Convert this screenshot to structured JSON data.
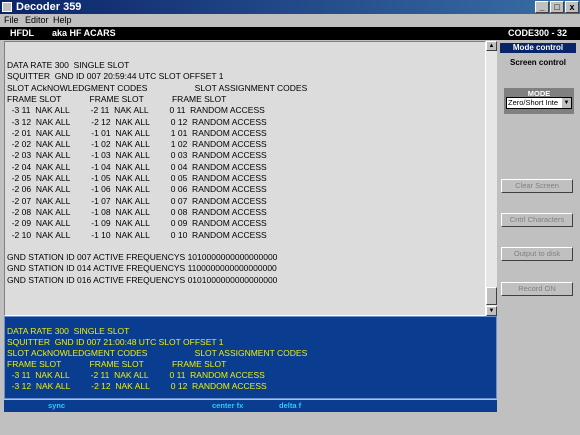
{
  "window": {
    "title": "Decoder 359"
  },
  "window_buttons": {
    "minimize": "_",
    "maximize": "□",
    "close": "x"
  },
  "menu": [
    "File",
    "Editor",
    "Help"
  ],
  "header": {
    "mode": "HFDL",
    "alias": "aka HF ACARS",
    "code": "CODE300 - 32"
  },
  "upper_lines": [
    "DATA RATE 300  SINGLE SLOT",
    "SQUITTER  GND ID 007 20:59:44 UTC SLOT OFFSET 1",
    "SLOT ACkNOWLEDGMENT CODES                    SLOT ASSIGNMENT CODES",
    "FRAME SLOT            FRAME SLOT            FRAME SLOT",
    "  -3 11  NAK ALL         -2 11  NAK ALL         0 11  RANDOM ACCESS",
    "  -3 12  NAK ALL         -2 12  NAK ALL         0 12  RANDOM ACCESS",
    "  -2 01  NAK ALL         -1 01  NAK ALL         1 01  RANDOM ACCESS",
    "  -2 02  NAK ALL         -1 02  NAK ALL         1 02  RANDOM ACCESS",
    "  -2 03  NAK ALL         -1 03  NAK ALL         0 03  RANDOM ACCESS",
    "  -2 04  NAK ALL         -1 04  NAK ALL         0 04  RANDOM ACCESS",
    "  -2 05  NAK ALL         -1 05  NAK ALL         0 05  RANDOM ACCESS",
    "  -2 06  NAK ALL         -1 06  NAK ALL         0 06  RANDOM ACCESS",
    "  -2 07  NAK ALL         -1 07  NAK ALL         0 07  RANDOM ACCESS",
    "  -2 08  NAK ALL         -1 08  NAK ALL         0 08  RANDOM ACCESS",
    "  -2 09  NAK ALL         -1 09  NAK ALL         0 09  RANDOM ACCESS",
    "  -2 10  NAK ALL         -1 10  NAK ALL         0 10  RANDOM ACCESS",
    "",
    "GND STATION ID 007 ACTIVE FREQUENCYS 1010000000000000000",
    "GND STATION ID 014 ACTIVE FREQUENCYS 1100000000000000000",
    "GND STATION ID 016 ACTIVE FREQUENCYS 0101000000000000000"
  ],
  "lower_lines": [
    "DATA RATE 300  SINGLE SLOT",
    "SQUITTER  GND ID 007 21:00:48 UTC SLOT OFFSET 1",
    "SLOT ACkNOWLEDGMENT CODES                    SLOT ASSIGNMENT CODES",
    "FRAME SLOT            FRAME SLOT            FRAME SLOT",
    "  -3 11  NAK ALL         -2 11  NAK ALL         0 11  RANDOM ACCESS",
    "  -3 12  NAK ALL         -2 12  NAK ALL         0 12  RANDOM ACCESS"
  ],
  "status": {
    "sync": "sync",
    "center": "center fx",
    "delta": "delta f"
  },
  "side": {
    "mode_control": "Mode control",
    "screen_control": "Screen control",
    "mode_label": "MODE",
    "mode_value": "Zero/Short Inte",
    "buttons": [
      "Clear Screen",
      "Cntrl Characters",
      "Output to disk",
      "Record ON"
    ]
  },
  "colors": {
    "lower_bg": "#0a3d8f",
    "lower_text": "#f0f000",
    "status_text": "#31c8ff"
  }
}
